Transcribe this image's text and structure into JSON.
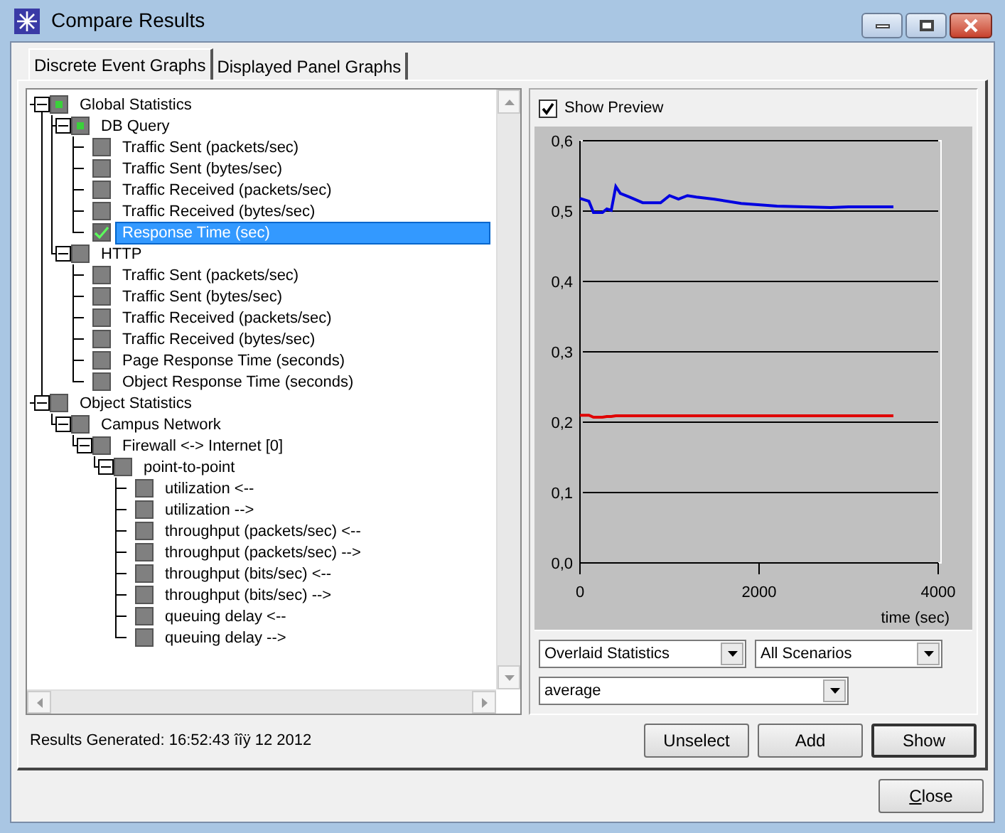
{
  "window": {
    "title": "Compare Results"
  },
  "tabs": [
    {
      "label": "Discrete Event Graphs",
      "selected": true
    },
    {
      "label": "Displayed Panel Graphs",
      "selected": false
    }
  ],
  "tree": [
    {
      "label": "Global Statistics",
      "checked": false,
      "partial": true,
      "expanded": true,
      "selected": false,
      "children": [
        {
          "label": "DB Query",
          "checked": false,
          "partial": true,
          "expanded": true,
          "selected": false,
          "children": [
            {
              "label": "Traffic Sent (packets/sec)",
              "checked": false,
              "selected": false
            },
            {
              "label": "Traffic Sent (bytes/sec)",
              "checked": false,
              "selected": false
            },
            {
              "label": "Traffic Received (packets/sec)",
              "checked": false,
              "selected": false
            },
            {
              "label": "Traffic Received (bytes/sec)",
              "checked": false,
              "selected": false
            },
            {
              "label": "Response Time (sec)",
              "checked": true,
              "selected": true
            }
          ]
        },
        {
          "label": "HTTP",
          "checked": false,
          "partial": false,
          "expanded": true,
          "selected": false,
          "children": [
            {
              "label": "Traffic Sent (packets/sec)",
              "checked": false,
              "selected": false
            },
            {
              "label": "Traffic Sent (bytes/sec)",
              "checked": false,
              "selected": false
            },
            {
              "label": "Traffic Received (packets/sec)",
              "checked": false,
              "selected": false
            },
            {
              "label": "Traffic Received (bytes/sec)",
              "checked": false,
              "selected": false
            },
            {
              "label": "Page Response Time (seconds)",
              "checked": false,
              "selected": false
            },
            {
              "label": "Object Response Time (seconds)",
              "checked": false,
              "selected": false
            }
          ]
        }
      ]
    },
    {
      "label": "Object Statistics",
      "checked": false,
      "partial": false,
      "expanded": true,
      "selected": false,
      "children": [
        {
          "label": "Campus Network",
          "checked": false,
          "partial": false,
          "expanded": true,
          "selected": false,
          "children": [
            {
              "label": "Firewall <-> Internet [0]",
              "checked": false,
              "partial": false,
              "expanded": true,
              "selected": false,
              "children": [
                {
                  "label": "point-to-point",
                  "checked": false,
                  "partial": false,
                  "expanded": true,
                  "selected": false,
                  "children": [
                    {
                      "label": "utilization <--",
                      "checked": false,
                      "selected": false
                    },
                    {
                      "label": "utilization -->",
                      "checked": false,
                      "selected": false
                    },
                    {
                      "label": "throughput (packets/sec) <--",
                      "checked": false,
                      "selected": false
                    },
                    {
                      "label": "throughput (packets/sec) -->",
                      "checked": false,
                      "selected": false
                    },
                    {
                      "label": "throughput (bits/sec) <--",
                      "checked": false,
                      "selected": false
                    },
                    {
                      "label": "throughput (bits/sec) -->",
                      "checked": false,
                      "selected": false
                    },
                    {
                      "label": "queuing delay <--",
                      "checked": false,
                      "selected": false
                    },
                    {
                      "label": "queuing delay -->",
                      "checked": false,
                      "selected": false
                    }
                  ]
                }
              ]
            }
          ]
        }
      ]
    }
  ],
  "preview": {
    "label": "Show Preview",
    "checked": true,
    "chart_data": {
      "type": "line",
      "xlabel": "time (sec)",
      "xlim": [
        0,
        4000
      ],
      "ylim": [
        0,
        0.6
      ],
      "grid": true,
      "xticks": [
        0,
        2000,
        4000
      ],
      "yticks": [
        {
          "value": 0,
          "label": "0,0"
        },
        {
          "value": 0.1,
          "label": "0,1"
        },
        {
          "value": 0.2,
          "label": "0,2"
        },
        {
          "value": 0.3,
          "label": "0,3"
        },
        {
          "value": 0.4,
          "label": "0,4"
        },
        {
          "value": 0.5,
          "label": "0,5"
        },
        {
          "value": 0.6,
          "label": "0,6"
        }
      ],
      "x": [
        0,
        100,
        150,
        250,
        300,
        350,
        400,
        450,
        550,
        700,
        900,
        1000,
        1100,
        1200,
        1300,
        1500,
        1800,
        2200,
        2800,
        3000,
        3500
      ],
      "series": [
        {
          "color": "#0000e0",
          "values": [
            0.518,
            0.514,
            0.498,
            0.498,
            0.503,
            0.501,
            0.535,
            0.525,
            0.52,
            0.512,
            0.512,
            0.522,
            0.517,
            0.522,
            0.52,
            0.517,
            0.511,
            0.507,
            0.505,
            0.506,
            0.506
          ]
        },
        {
          "color": "#e00000",
          "values": [
            0.21,
            0.21,
            0.207,
            0.207,
            0.208,
            0.208,
            0.209,
            0.209,
            0.209,
            0.209,
            0.209,
            0.209,
            0.209,
            0.209,
            0.209,
            0.209,
            0.209,
            0.209,
            0.209,
            0.209,
            0.209
          ]
        }
      ]
    },
    "selects": [
      {
        "value": "Overlaid Statistics"
      },
      {
        "value": "All Scenarios"
      },
      {
        "value": "average"
      }
    ]
  },
  "status": "Results Generated: 16:52:43 îîÿ 12 2012",
  "actions": [
    "Unselect",
    "Add",
    "Show"
  ],
  "close": "Close"
}
